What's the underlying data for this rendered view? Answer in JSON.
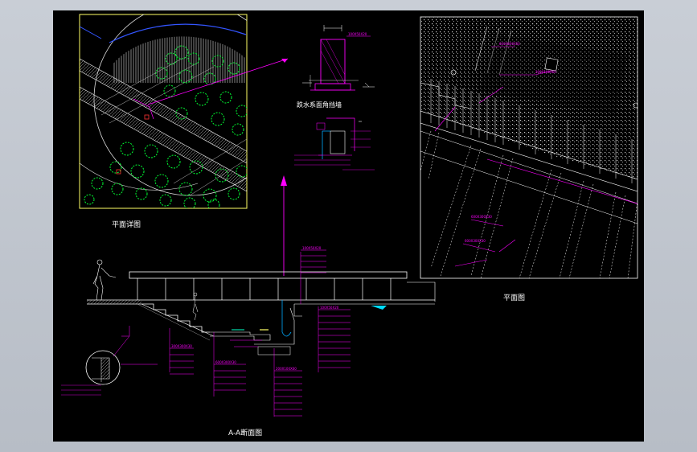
{
  "drawing": {
    "background": "#000000",
    "line_color_magenta": "#ff00ff",
    "line_color_green": "#00ff33",
    "line_color_white": "#ffffff",
    "line_color_yellow": "#ffff66",
    "line_color_blue": "#3355ff"
  },
  "titles": {
    "plan_detail": "平面详图",
    "plan": "平面图",
    "section_aa": "A-A断面图",
    "wall_detail": "跌水系面角挡墙"
  }
}
